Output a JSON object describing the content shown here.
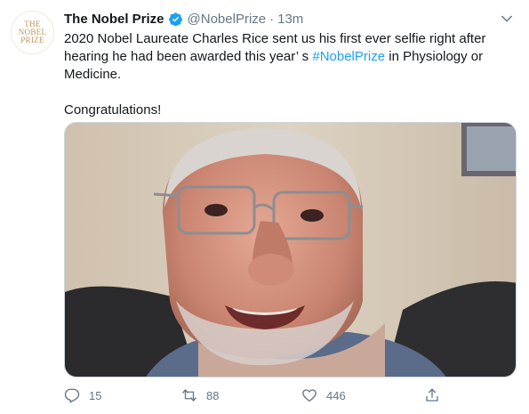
{
  "author": {
    "name": "The Nobel Prize",
    "handle": "@NobelPrize",
    "separator": "·",
    "time": "13m",
    "avatar_lines": [
      "THE",
      "NOBEL",
      "PRIZE"
    ]
  },
  "tweet": {
    "line1_pre": "2020 Nobel Laureate Charles Rice sent us his first ever selfie right after hearing he had been awarded this year’  s ",
    "hashtag": "#NobelPrize",
    "line1_post": " in Physiology or Medicine.",
    "line2": "Congratulations!"
  },
  "media": {
    "alt": "selfie photo of a smiling man with glasses"
  },
  "actions": {
    "replies": "15",
    "retweets": "88",
    "likes": "446"
  },
  "colors": {
    "accent": "#1da1f2",
    "muted": "#657786",
    "gold": "#b8955a"
  },
  "icons": [
    "verified-badge-icon",
    "chevron-down-icon",
    "reply-icon",
    "retweet-icon",
    "like-icon",
    "share-icon"
  ]
}
